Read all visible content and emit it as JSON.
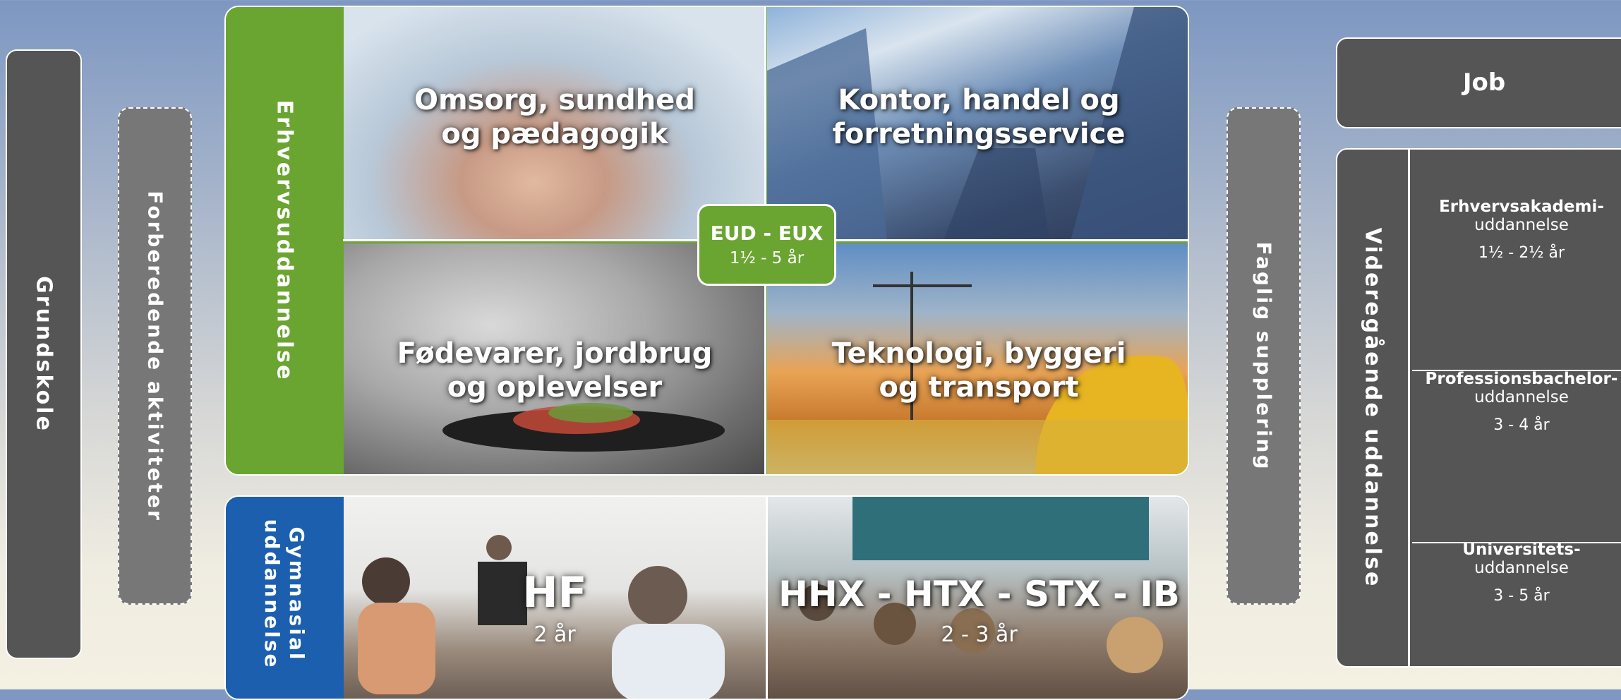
{
  "left_bars": {
    "grundskole": "Grundskole",
    "forberedende": "Forberedende aktiviteter"
  },
  "eud": {
    "side_label": "Erhvervsuddannelse",
    "badge_title": "EUD - EUX",
    "badge_years": "1½ - 5 år",
    "tiles": [
      {
        "line1": "Omsorg, sundhed",
        "line2": "og pædagogik"
      },
      {
        "line1": "Kontor, handel og",
        "line2": "forretningsservice"
      },
      {
        "line1": "Fødevarer, jordbrug",
        "line2": "og oplevelser"
      },
      {
        "line1": "Teknologi, byggeri",
        "line2": "og transport"
      }
    ]
  },
  "gym": {
    "side_label_1": "Gymnasial",
    "side_label_2": "uddannelse",
    "tiles": [
      {
        "title": "HF",
        "years": "2 år"
      },
      {
        "title": "HHX - HTX - STX - IB",
        "years": "2 - 3 år"
      }
    ]
  },
  "faglig": "Faglig supplering",
  "job": "Job",
  "videregaaende": {
    "side_label": "Videregående uddannelse",
    "rows": [
      {
        "name": "Erhvervsakademi",
        "suffix": "uddannelse",
        "years": "1½ - 2½ år"
      },
      {
        "name": "Professionsbachelor",
        "suffix": "uddannelse",
        "years": "3 - 4 år"
      },
      {
        "name": "Universitets",
        "suffix": "uddannelse",
        "years": "3 - 5 år"
      }
    ]
  },
  "colors": {
    "eud_green": "#6aa531",
    "gym_blue": "#1b5fae",
    "dark_grey": "#555555",
    "mid_grey": "#777777"
  }
}
